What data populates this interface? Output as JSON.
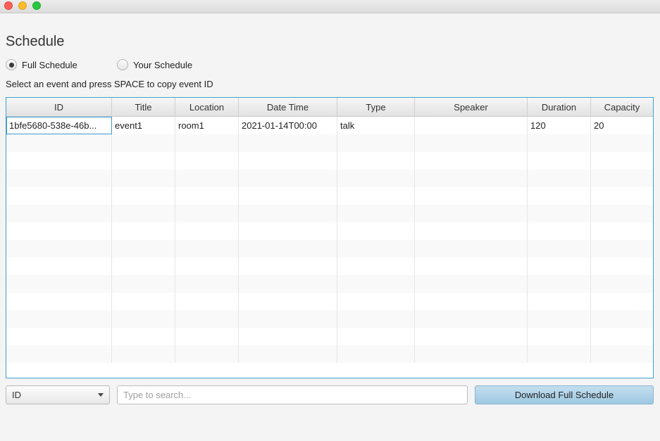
{
  "window": {
    "controls": [
      "close",
      "minimize",
      "maximize"
    ]
  },
  "page_title": "Schedule",
  "view_toggle": [
    {
      "label": "Full Schedule",
      "selected": true
    },
    {
      "label": "Your Schedule",
      "selected": false
    }
  ],
  "hint": "Select an event and press SPACE to copy event ID",
  "table": {
    "columns": [
      "ID",
      "Title",
      "Location",
      "Date Time",
      "Type",
      "Speaker",
      "Duration",
      "Capacity"
    ],
    "rows": [
      [
        "1bfe5680-538e-46b...",
        "event1",
        "room1",
        "2021-01-14T00:00",
        "talk",
        "",
        "120",
        "20"
      ]
    ],
    "total_visible_rows": 14
  },
  "search": {
    "field_selected": "ID",
    "placeholder": "Type to search...",
    "value": ""
  },
  "download_button": "Download Full Schedule",
  "colors": {
    "accent": "#3ea2cf",
    "button": "#a9cfe6"
  }
}
